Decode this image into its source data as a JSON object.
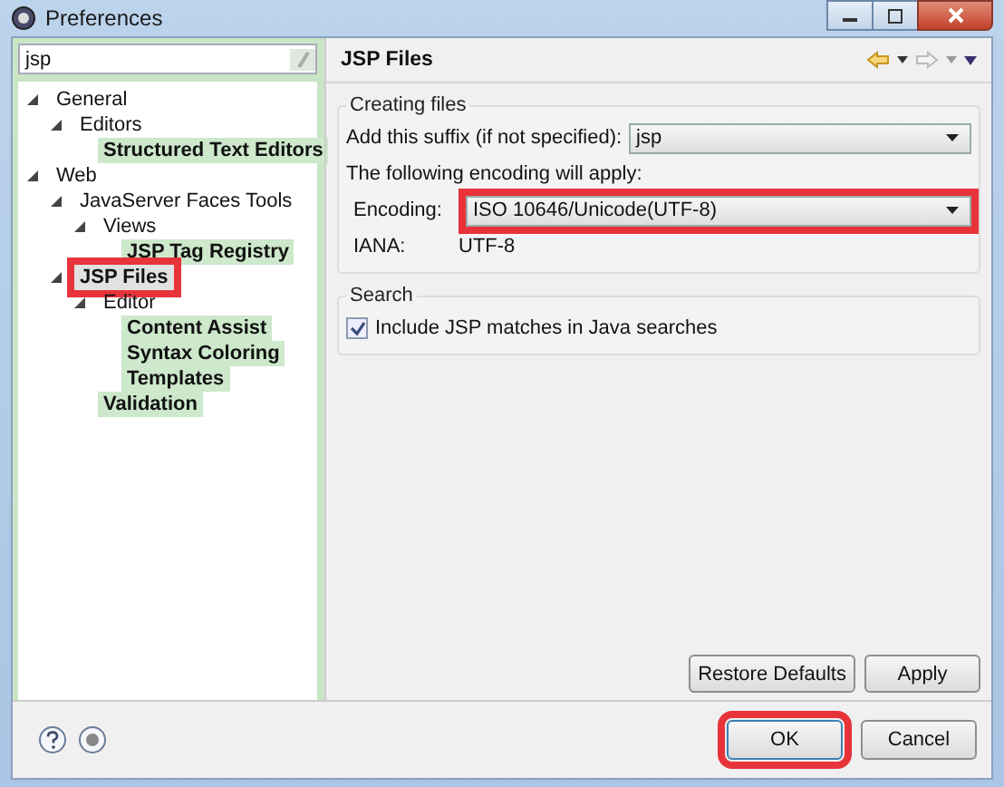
{
  "window": {
    "title": "Preferences"
  },
  "filter": {
    "value": "jsp"
  },
  "tree": [
    {
      "label": "General",
      "expanded": true,
      "matched": false,
      "selected": false,
      "highlighted": false,
      "children": [
        {
          "label": "Editors",
          "expanded": true,
          "matched": false,
          "selected": false,
          "highlighted": false,
          "children": [
            {
              "label": "Structured Text Editors",
              "matched": true,
              "selected": false,
              "highlighted": false
            }
          ]
        }
      ]
    },
    {
      "label": "Web",
      "expanded": true,
      "matched": false,
      "selected": false,
      "highlighted": false,
      "children": [
        {
          "label": "JavaServer Faces Tools",
          "expanded": true,
          "matched": false,
          "selected": false,
          "highlighted": false,
          "children": [
            {
              "label": "Views",
              "expanded": true,
              "matched": false,
              "selected": false,
              "highlighted": false,
              "children": [
                {
                  "label": "JSP Tag Registry",
                  "matched": true,
                  "selected": false,
                  "highlighted": false
                }
              ]
            }
          ]
        },
        {
          "label": "JSP Files",
          "expanded": true,
          "matched": true,
          "selected": true,
          "highlighted": true,
          "children": [
            {
              "label": "Editor",
              "expanded": true,
              "matched": false,
              "selected": false,
              "highlighted": false,
              "children": [
                {
                  "label": "Content Assist",
                  "matched": true,
                  "selected": false,
                  "highlighted": false
                },
                {
                  "label": "Syntax Coloring",
                  "matched": true,
                  "selected": false,
                  "highlighted": false
                },
                {
                  "label": "Templates",
                  "matched": true,
                  "selected": false,
                  "highlighted": false
                }
              ]
            },
            {
              "label": "Validation",
              "matched": true,
              "selected": false,
              "highlighted": false
            }
          ]
        }
      ]
    }
  ],
  "page": {
    "title": "JSP Files",
    "creating_group": {
      "title": "Creating files",
      "suffix_label": "Add this suffix (if not specified):",
      "suffix_value": "jsp",
      "encoding_note": "The following encoding will apply:",
      "encoding_label": "Encoding:",
      "encoding_value": "ISO 10646/Unicode(UTF-8)",
      "encoding_highlighted": true,
      "iana_label": "IANA:",
      "iana_value": "UTF-8"
    },
    "search_group": {
      "title": "Search",
      "checkbox_label": "Include JSP matches in Java searches",
      "checked": true
    },
    "buttons": [
      {
        "label": "Restore Defaults"
      },
      {
        "label": "Apply"
      }
    ]
  },
  "dialog_buttons": [
    {
      "label": "OK",
      "highlighted": true
    },
    {
      "label": "Cancel",
      "highlighted": false
    }
  ]
}
